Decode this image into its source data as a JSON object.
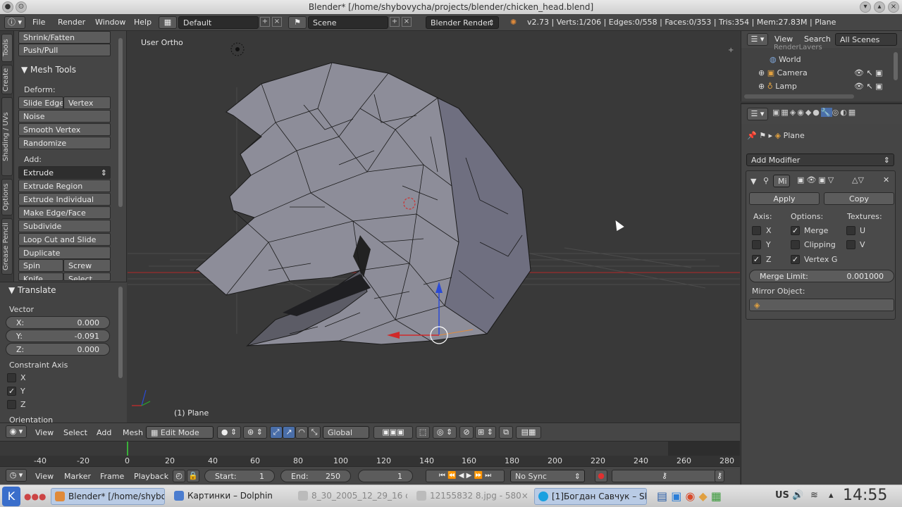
{
  "window": {
    "title": "Blender* [/home/shybovycha/projects/blender/chicken_head.blend]"
  },
  "infobar": {
    "menus": [
      "File",
      "Render",
      "Window",
      "Help"
    ],
    "layout": "Default",
    "scene": "Scene",
    "engine": "Blender Render",
    "stats": "v2.73 | Verts:1/206 | Edges:0/558 | Faces:0/353 | Tris:354 | Mem:27.83M | Plane"
  },
  "tabs": [
    "Tools",
    "Create",
    "Shading / UVs",
    "Options",
    "Grease Pencil"
  ],
  "toolshelf": {
    "top_buttons": [
      "Shrink/Fatten",
      "Push/Pull"
    ],
    "mesh_tools_header": "Mesh Tools",
    "deform_label": "Deform:",
    "slide_edge": "Slide Edge",
    "vertex": "Vertex",
    "noise": "Noise",
    "smooth_vertex": "Smooth Vertex",
    "randomize": "Randomize",
    "add_label": "Add:",
    "extrude": "Extrude",
    "extrude_region": "Extrude Region",
    "extrude_individual": "Extrude Individual",
    "make_edge_face": "Make Edge/Face",
    "subdivide": "Subdivide",
    "loop_cut": "Loop Cut and Slide",
    "duplicate": "Duplicate",
    "spin": "Spin",
    "screw": "Screw",
    "knife": "Knife",
    "select": "Select"
  },
  "operator": {
    "header": "Translate",
    "vector_label": "Vector",
    "x_label": "X:",
    "x": "0.000",
    "y_label": "Y:",
    "y": "-0.091",
    "z_label": "Z:",
    "z": "0.000",
    "constraint_label": "Constraint Axis",
    "cx": "X",
    "cy": "Y",
    "cz": "Z",
    "orientation_label": "Orientation"
  },
  "viewport": {
    "view_name": "User Ortho",
    "object_label": "(1) Plane"
  },
  "viewheader": {
    "menus": [
      "View",
      "Select",
      "Add",
      "Mesh"
    ],
    "mode": "Edit Mode",
    "orientation": "Global"
  },
  "timeline": {
    "ticks": [
      "-40",
      "-20",
      "0",
      "20",
      "40",
      "60",
      "80",
      "100",
      "120",
      "140",
      "160",
      "180",
      "200",
      "220",
      "240",
      "260",
      "280"
    ],
    "menus": [
      "View",
      "Marker",
      "Frame",
      "Playback"
    ],
    "start_label": "Start:",
    "start": "1",
    "end_label": "End:",
    "end": "250",
    "current": "1",
    "sync": "No Sync"
  },
  "outliner": {
    "view": "View",
    "search": "Search",
    "scope": "All Scenes",
    "partial": "RenderLayers",
    "items": [
      "World",
      "Camera",
      "Lamp"
    ]
  },
  "properties": {
    "object": "Plane",
    "add_modifier": "Add Modifier",
    "mod_name": "Mi",
    "apply": "Apply",
    "copy": "Copy",
    "axis_label": "Axis:",
    "options_label": "Options:",
    "textures_label": "Textures:",
    "x": "X",
    "y": "Y",
    "z": "Z",
    "merge": "Merge",
    "clipping": "Clipping",
    "vertex_g": "Vertex G",
    "u": "U",
    "v": "V",
    "merge_limit_label": "Merge Limit:",
    "merge_limit": "0.001000",
    "mirror_object_label": "Mirror Object:"
  },
  "taskbar": {
    "tasks": [
      "Blender* [/home/shybovy",
      "Картинки – Dolphin",
      "8_30_2005_12_29_16 c",
      "12155832 8.jpg - 580×",
      "[1]Богдан Савчук – Skype"
    ],
    "lang": "US",
    "time": "14:55"
  }
}
